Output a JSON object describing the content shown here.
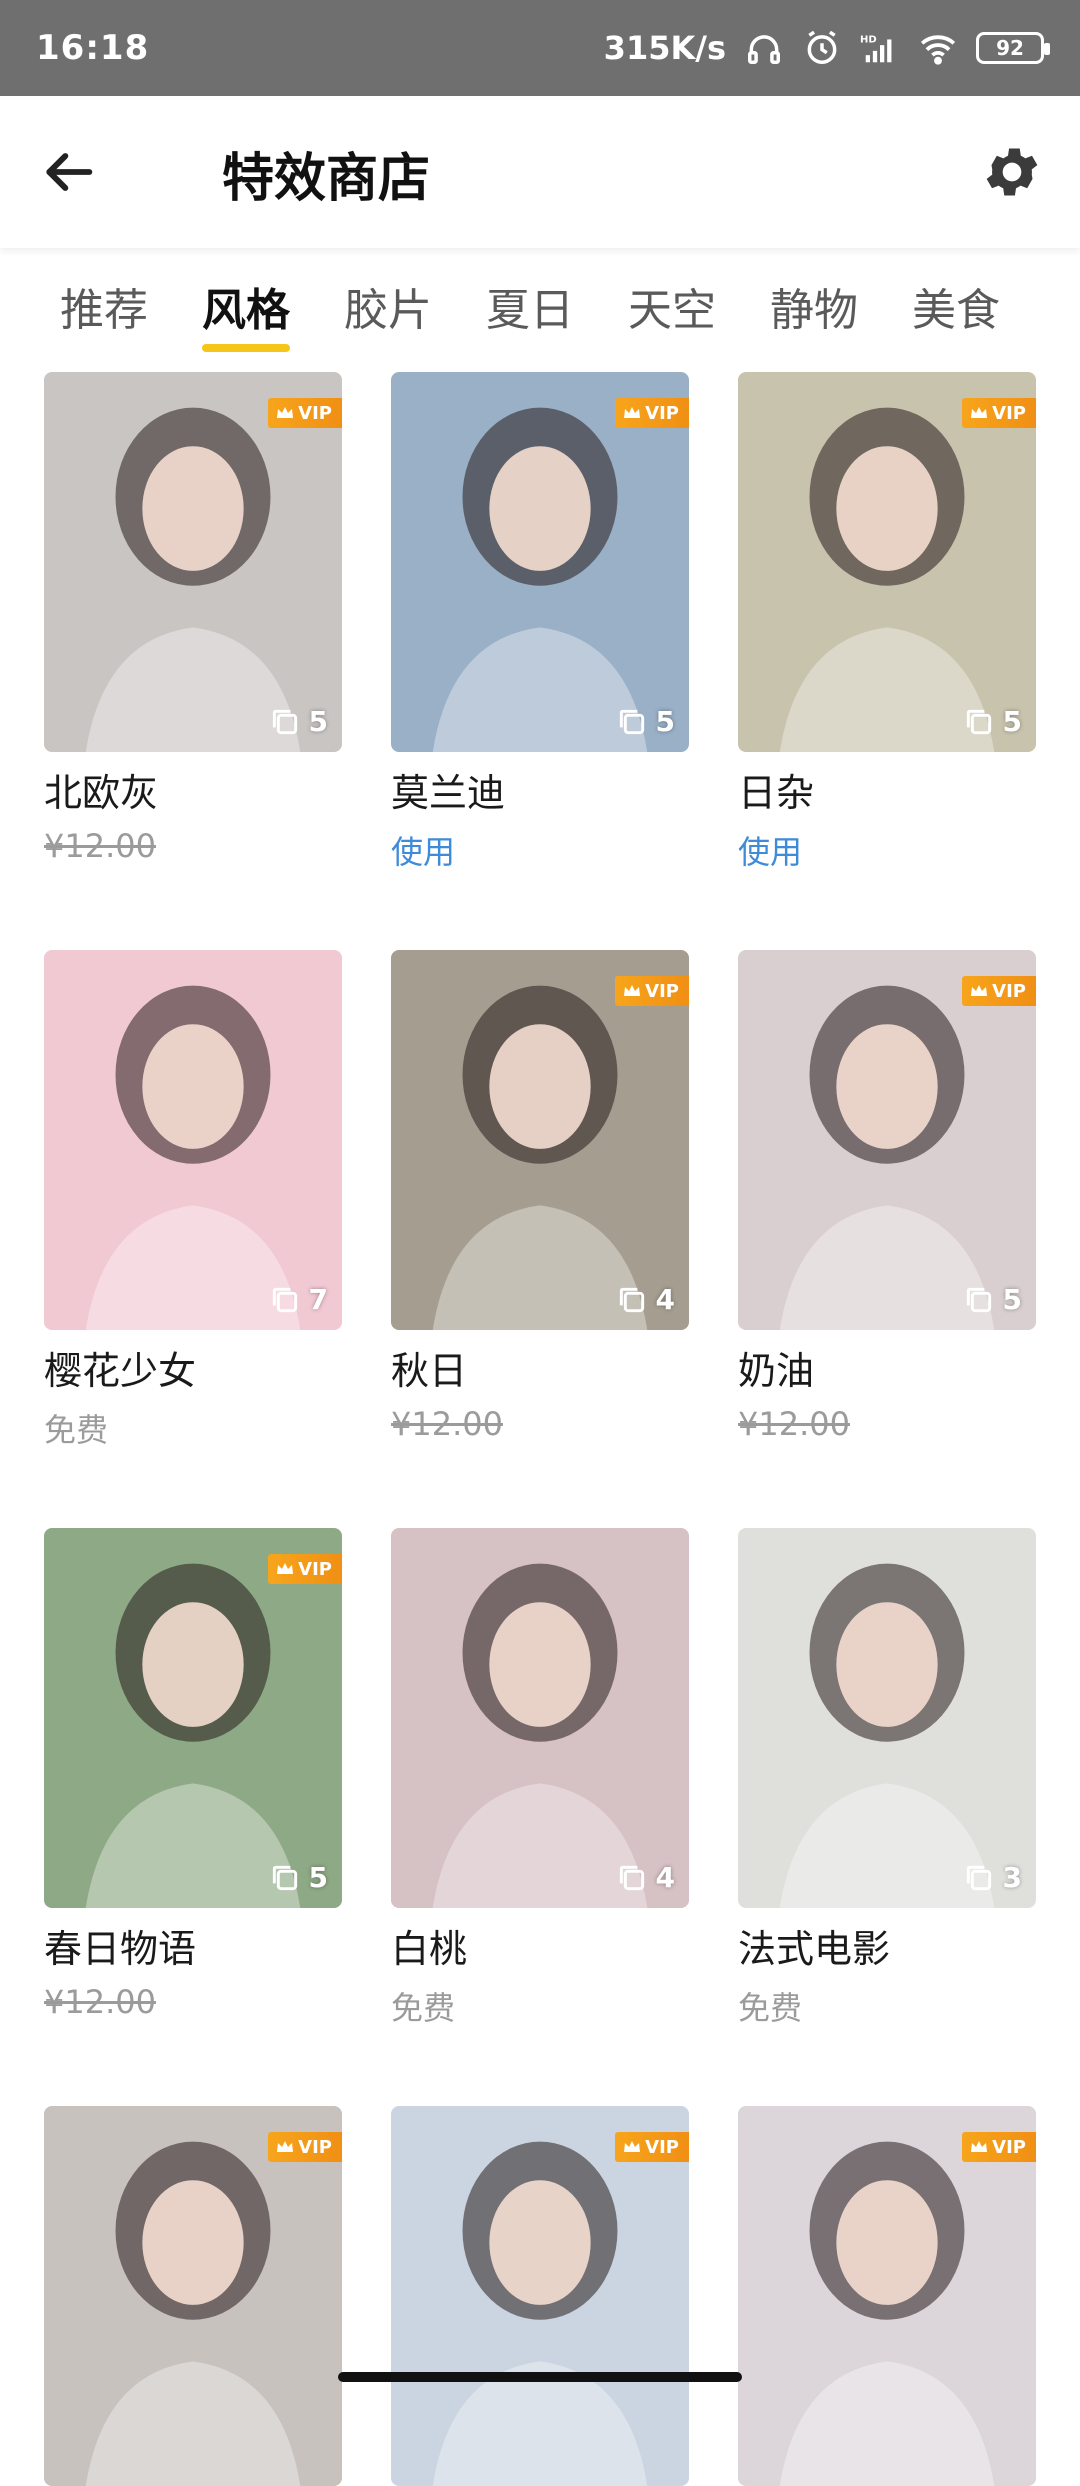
{
  "status_bar": {
    "time": "16:18",
    "speed": "315K/s",
    "battery": "92",
    "icons": [
      "headphone-icon",
      "alarm-icon",
      "hd-signal-icon",
      "wifi-icon",
      "battery-icon"
    ]
  },
  "header": {
    "title": "特效商店",
    "back_icon": "arrow-left-icon",
    "settings_icon": "gear-icon"
  },
  "tabs": [
    {
      "label": "推荐"
    },
    {
      "label": "风格"
    },
    {
      "label": "胶片"
    },
    {
      "label": "夏日"
    },
    {
      "label": "天空"
    },
    {
      "label": "静物"
    },
    {
      "label": "美食"
    }
  ],
  "active_tab": "风格",
  "vip_label": "VIP",
  "effects": [
    {
      "name": "北欧灰",
      "price": "¥12.00",
      "price_style": "strike",
      "vip": true,
      "count": "5",
      "bg": "#c9c5c3"
    },
    {
      "name": "莫兰迪",
      "price": "使用",
      "price_style": "use",
      "vip": true,
      "count": "5",
      "bg": "#9ab0c6"
    },
    {
      "name": "日杂",
      "price": "使用",
      "price_style": "use",
      "vip": true,
      "count": "5",
      "bg": "#c8c3ad"
    },
    {
      "name": "樱花少女",
      "price": "免费",
      "price_style": "free",
      "vip": false,
      "count": "7",
      "bg": "#f1c9d3"
    },
    {
      "name": "秋日",
      "price": "¥12.00",
      "price_style": "strike",
      "vip": true,
      "count": "4",
      "bg": "#a59e90"
    },
    {
      "name": "奶油",
      "price": "¥12.00",
      "price_style": "strike",
      "vip": true,
      "count": "5",
      "bg": "#d9cfd0"
    },
    {
      "name": "春日物语",
      "price": "¥12.00",
      "price_style": "strike",
      "vip": true,
      "count": "5",
      "bg": "#8ea985"
    },
    {
      "name": "白桃",
      "price": "免费",
      "price_style": "free",
      "vip": false,
      "count": "4",
      "bg": "#d6c1c4"
    },
    {
      "name": "法式电影",
      "price": "免费",
      "price_style": "free",
      "vip": false,
      "count": "3",
      "bg": "#dfe0dc"
    },
    {
      "name": "",
      "price": "",
      "price_style": "free",
      "vip": true,
      "count": "",
      "bg": "#c8c2bf"
    },
    {
      "name": "",
      "price": "",
      "price_style": "free",
      "vip": true,
      "count": "",
      "bg": "#cbd5e1"
    },
    {
      "name": "",
      "price": "",
      "price_style": "free",
      "vip": true,
      "count": "",
      "bg": "#dcd6db"
    }
  ]
}
